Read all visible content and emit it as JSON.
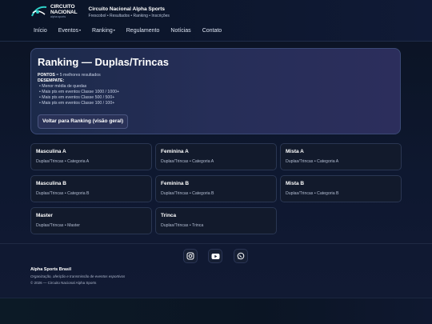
{
  "brand": {
    "logo_line1": "CIRCUITO",
    "logo_line2": "NACIONAL",
    "logo_sub": "alpha sports",
    "title": "Circuito Nacional Alpha Sports",
    "tagline": "Frescobol • Resultados • Ranking • Inscrições"
  },
  "nav": {
    "items": [
      {
        "label": "Início",
        "dropdown": false
      },
      {
        "label": "Eventos",
        "dropdown": true
      },
      {
        "label": "Ranking",
        "dropdown": true
      },
      {
        "label": "Regulamento",
        "dropdown": false
      },
      {
        "label": "Notícias",
        "dropdown": false
      },
      {
        "label": "Contato",
        "dropdown": false
      }
    ],
    "caret": "▾"
  },
  "hero": {
    "title": "Ranking — Duplas/Trincas",
    "points_label": "PONTOS",
    "points_text": " = 5 melhores resultados",
    "tiebreak_label": "DESEMPATE:",
    "tiebreak_items": [
      "• Menor média de quedas",
      "• Mais pts em eventos Classe 1000 / 1000+",
      "• Mais pts em eventos Classe 500 / 500+",
      "• Mais pts em eventos Classe 100 / 100+"
    ],
    "back_button": "Voltar para Ranking (visão geral)"
  },
  "categories": [
    {
      "title": "Masculina A",
      "sub": "Duplas/Trincas • Categoria A"
    },
    {
      "title": "Feminina A",
      "sub": "Duplas/Trincas • Categoria A"
    },
    {
      "title": "Mista A",
      "sub": "Duplas/Trincas • Categoria A"
    },
    {
      "title": "Masculina B",
      "sub": "Duplas/Trincas • Categoria B"
    },
    {
      "title": "Feminina B",
      "sub": "Duplas/Trincas • Categoria B"
    },
    {
      "title": "Mista B",
      "sub": "Duplas/Trincas • Categoria B"
    },
    {
      "title": "Master",
      "sub": "Duplas/Trincas • Master"
    },
    {
      "title": "Trinca",
      "sub": "Duplas/Trincas • Trinca"
    }
  ],
  "social": {
    "icons": [
      "instagram-icon",
      "youtube-icon",
      "whatsapp-icon"
    ]
  },
  "footer": {
    "org": "Alpha Sports Brasil",
    "description": "Organização, aferição e transmissão de eventos esportivos",
    "copyright": "© 2026 — Circuito Nacional Alpha Sports"
  },
  "colors": {
    "background": "#0e1830",
    "hero_border": "#3b4a76",
    "card_bg": "#121a2c",
    "accent": "#2fd0c8"
  }
}
